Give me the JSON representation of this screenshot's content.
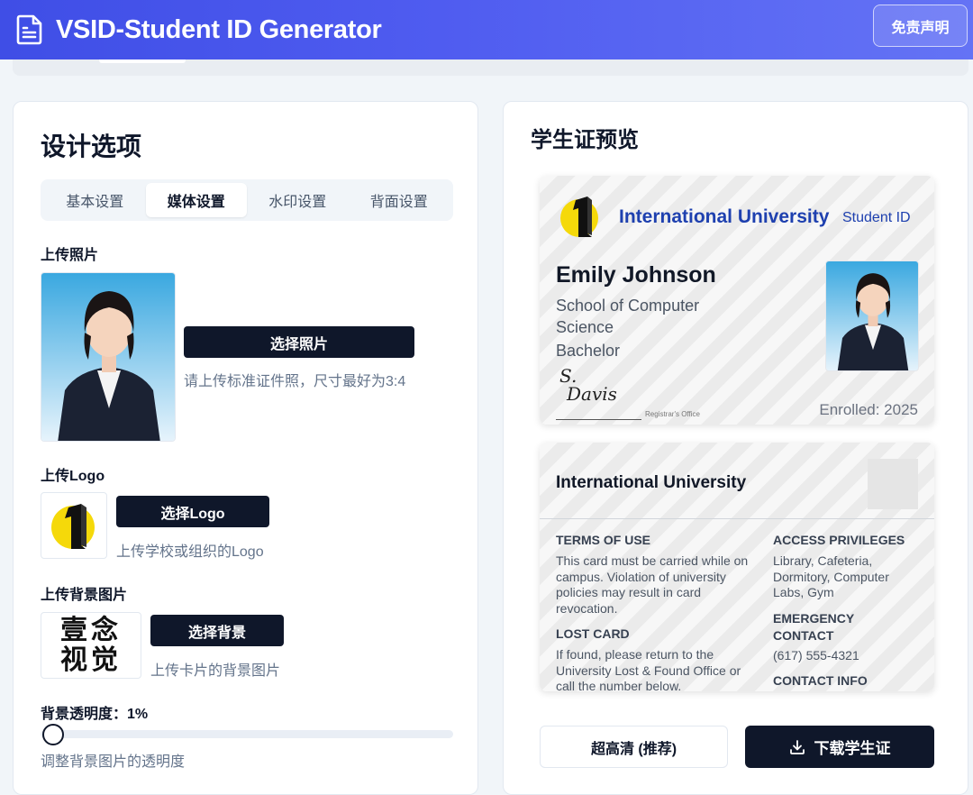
{
  "header": {
    "title": "VSID-Student ID Generator",
    "disclaimer_label": "免责声明"
  },
  "design_panel": {
    "title": "设计选项",
    "tabs": [
      {
        "label": "基本设置",
        "active": false
      },
      {
        "label": "媒体设置",
        "active": true
      },
      {
        "label": "水印设置",
        "active": false
      },
      {
        "label": "背面设置",
        "active": false
      }
    ],
    "photo": {
      "label": "上传照片",
      "button": "选择照片",
      "hint": "请上传标准证件照，尺寸最好为3:4"
    },
    "logo": {
      "label": "上传Logo",
      "button": "选择Logo",
      "hint": "上传学校或组织的Logo"
    },
    "background": {
      "label": "上传背景图片",
      "thumb_text_line1": "壹念",
      "thumb_text_line2": "视觉",
      "button": "选择背景",
      "hint": "上传卡片的背景图片"
    },
    "opacity": {
      "label": "背景透明度：1%",
      "value_percent": 1,
      "hint": "调整背景图片的透明度"
    }
  },
  "preview_panel": {
    "title": "学生证预览",
    "front": {
      "university": "International University",
      "student_id_label": "Student ID",
      "name": "Emily Johnson",
      "school": "School of Computer Science",
      "degree": "Bachelor",
      "signature_line1": "S.",
      "signature_line2": "Davis",
      "registrar": "Registrar's Office",
      "enrolled": "Enrolled: 2025"
    },
    "back": {
      "university": "International University",
      "terms_heading": "TERMS OF USE",
      "terms_text": "This card must be carried while on campus. Violation of university policies may result in card revocation.",
      "lost_heading": "LOST CARD",
      "lost_text": "If found, please return to the University Lost & Found Office or call the number below.",
      "access_heading": "ACCESS PRIVILEGES",
      "access_text": "Library, Cafeteria, Dormitory, Computer Labs, Gym",
      "emergency_heading": "EMERGENCY CONTACT",
      "emergency_text": "(617) 555-4321",
      "contact_heading": "CONTACT INFO"
    },
    "quality_button": "超高清 (推荐)",
    "download_button": "下载学生证"
  },
  "colors": {
    "header_start": "#3f4ee6",
    "header_end": "#6473f5",
    "dark_button": "#0f172a",
    "university_blue": "#1e40af",
    "logo_yellow": "#f5d90a"
  },
  "icons": {
    "app": "document-icon",
    "download": "download-icon"
  }
}
